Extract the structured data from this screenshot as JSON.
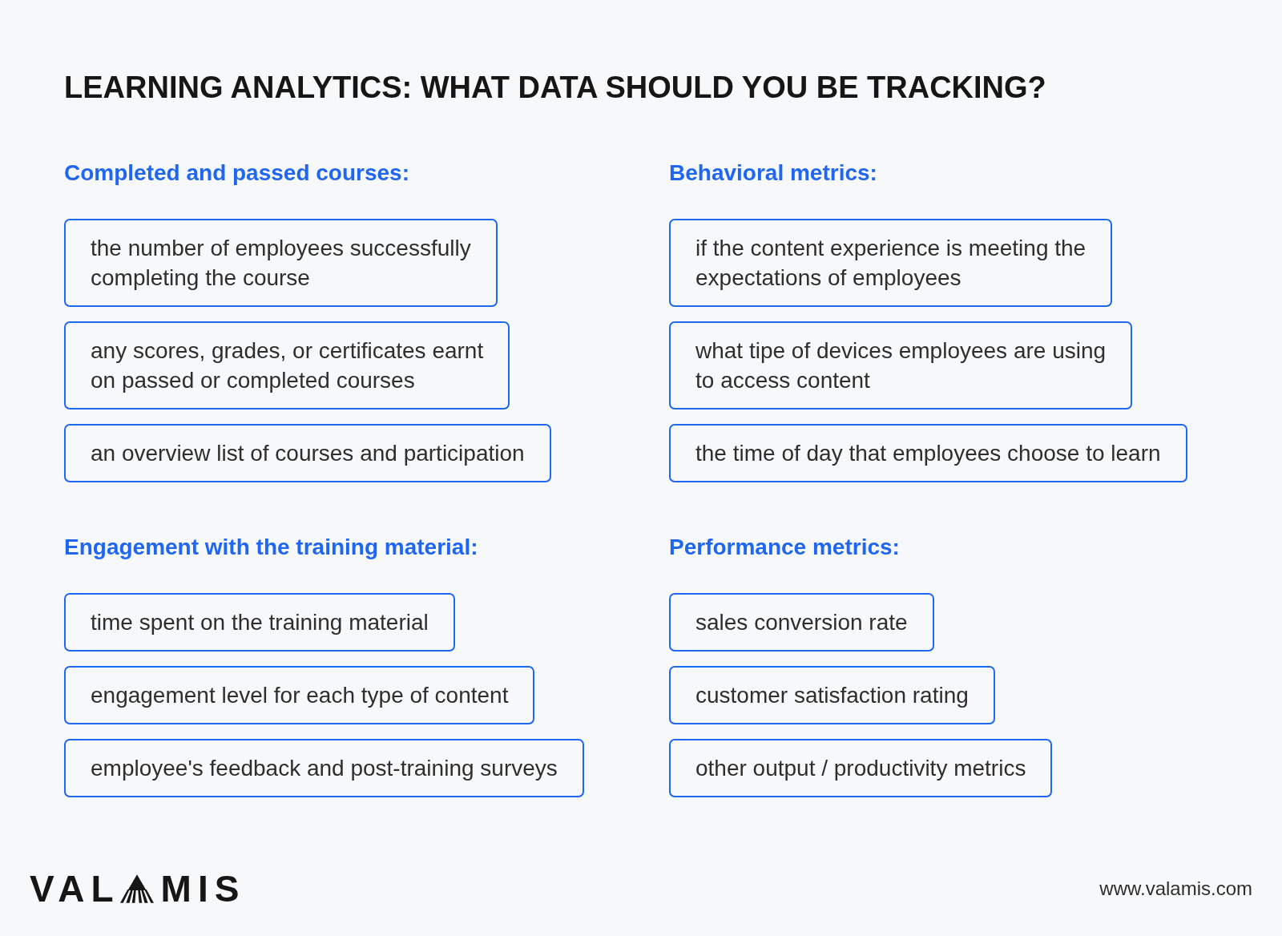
{
  "title": "LEARNING ANALYTICS: WHAT DATA SHOULD YOU BE TRACKING?",
  "sections": [
    {
      "heading": "Completed and passed courses:",
      "items": [
        "the number of employees successfully\ncompleting the course",
        "any scores, grades, or certificates earnt\non passed or completed courses",
        "an overview list of courses and participation"
      ]
    },
    {
      "heading": "Behavioral metrics:",
      "items": [
        "if the content experience is meeting the\nexpectations of employees",
        "what tipe of devices employees are using\nto access content",
        "the time of day that employees choose to learn"
      ]
    },
    {
      "heading": "Engagement with the training material:",
      "items": [
        "time spent on the training material",
        "engagement level for each type of content",
        "employee's feedback and post-training surveys"
      ]
    },
    {
      "heading": "Performance metrics:",
      "items": [
        "sales conversion rate",
        "customer satisfaction rating",
        "other output / productivity metrics"
      ]
    }
  ],
  "footer": {
    "logo": {
      "text_before": "VAL",
      "text_after": "MIS"
    },
    "url": "www.valamis.com"
  }
}
